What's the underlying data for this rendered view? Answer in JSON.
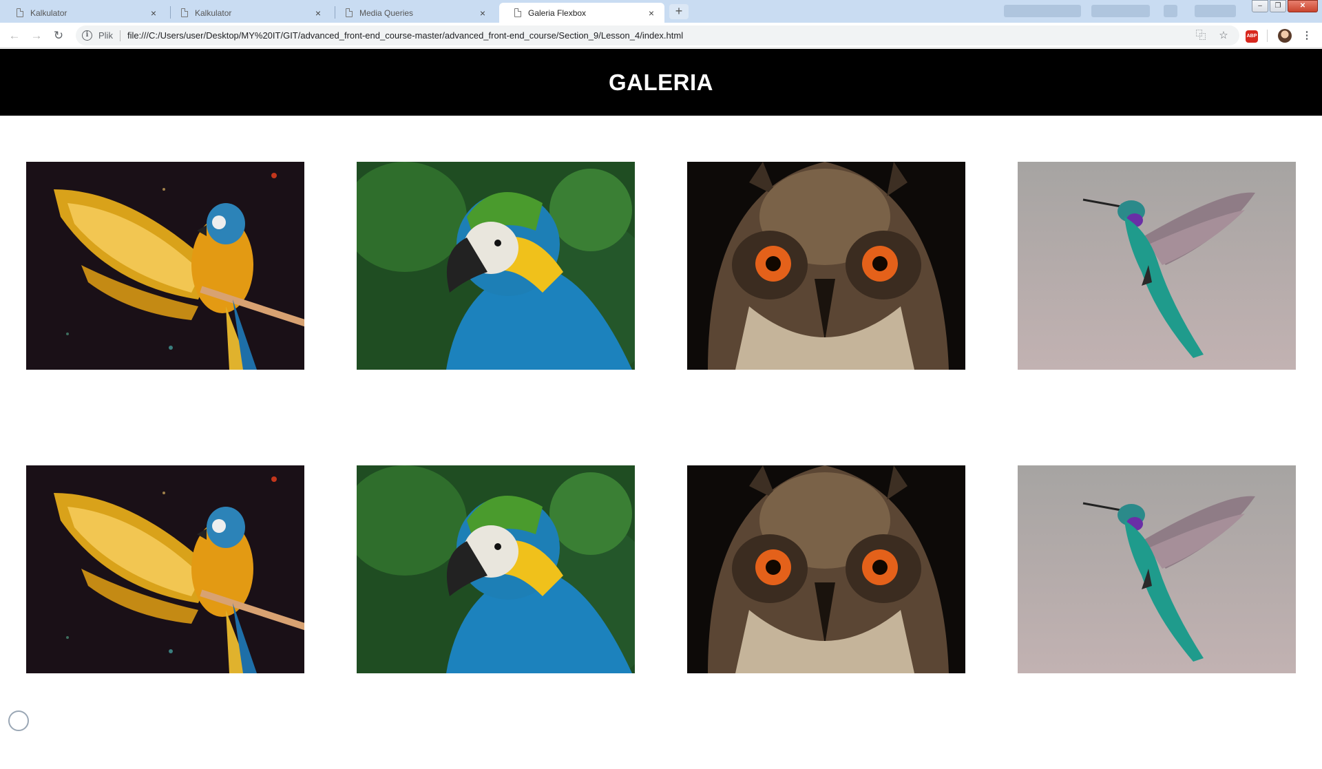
{
  "browser": {
    "tabs": [
      {
        "title": "Kalkulator",
        "close": "×"
      },
      {
        "title": "Kalkulator",
        "close": "×"
      },
      {
        "title": "Media Queries",
        "close": "×"
      },
      {
        "title": "Galeria Flexbox",
        "close": "×",
        "active": true
      }
    ],
    "new_tab": "+",
    "address": {
      "scheme_label": "Plik",
      "url": "file:///C:/Users/user/Desktop/MY%20IT/GIT/advanced_front-end_course-master/advanced_front-end_course/Section_9/Lesson_4/index.html"
    },
    "icons": {
      "back": "arrow-left-icon",
      "forward": "arrow-right-icon",
      "reload": "reload-icon",
      "info": "info-icon",
      "translate": "translate-icon",
      "bookmark": "star-icon",
      "adblock": "abp-icon",
      "profile": "avatar",
      "menu": "kebab-menu-icon"
    },
    "abp_label": "ABP"
  },
  "page": {
    "title": "GALERIA",
    "header_color": "#000000",
    "images": [
      {
        "subject": "macaw-wings-spread"
      },
      {
        "subject": "macaw-portrait"
      },
      {
        "subject": "owl-face"
      },
      {
        "subject": "hummingbird"
      },
      {
        "subject": "macaw-wings-spread"
      },
      {
        "subject": "macaw-portrait"
      },
      {
        "subject": "owl-face"
      },
      {
        "subject": "hummingbird"
      }
    ]
  }
}
